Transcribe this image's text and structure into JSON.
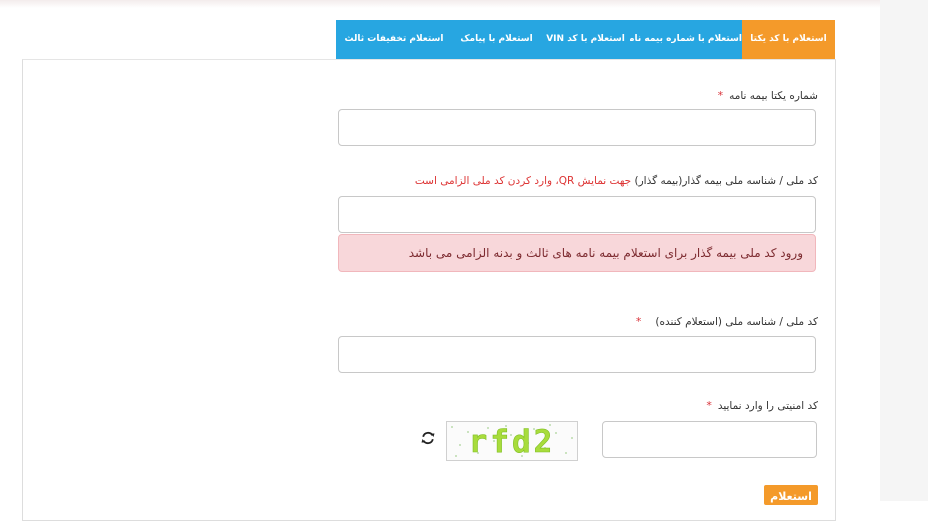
{
  "tabs": [
    {
      "label": "استعلام با کد یکتا",
      "active": true
    },
    {
      "label": "استعلام با شماره بیمه نامه",
      "active": false
    },
    {
      "label": "استعلام با کد VIN",
      "active": false
    },
    {
      "label": "استعلام با پیامک",
      "active": false
    },
    {
      "label": "استعلام تخفیفات ثالث",
      "active": false
    }
  ],
  "form": {
    "unique_code_label": "شماره یکتا بیمه نامه",
    "required_mark": "*",
    "insurer_id_label": "کد ملی / شناسه ملی بیمه گذار(بیمه گذار)",
    "insurer_id_hint": "جهت نمایش QR، وارد کردن کد ملی الزامی است",
    "alert_text": "ورود کد ملی بیمه گذار برای استعلام بیمه نامه های ثالث و بدنه الزامی می باشد",
    "inquirer_id_label": "کد ملی / شناسه ملی (استعلام کننده)",
    "captcha_label": "کد امنیتی را وارد نمایید",
    "captcha_text": "rfd2",
    "submit_label": "استعلام"
  },
  "colors": {
    "tab": "#27a6e1",
    "tab_active": "#f49a2a",
    "required": "#d9343b",
    "alert_bg": "#f8d7da"
  },
  "icons": {
    "refresh": "refresh-icon"
  }
}
